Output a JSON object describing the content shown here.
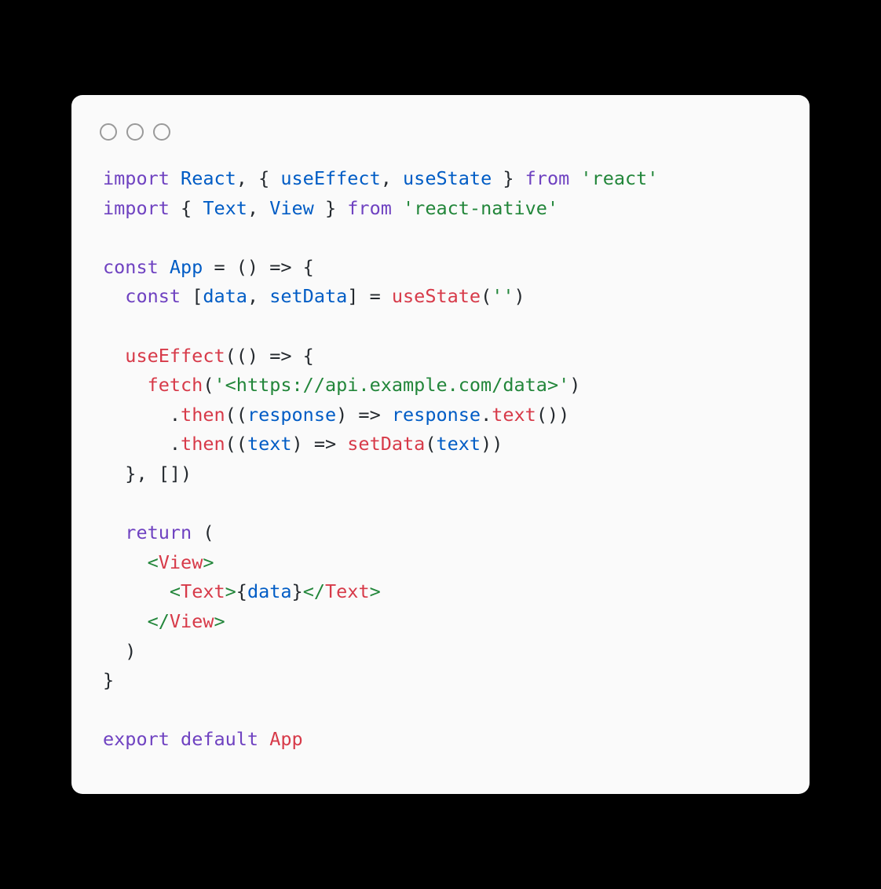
{
  "code": {
    "lines": [
      [
        {
          "t": "import ",
          "c": "kw"
        },
        {
          "t": "React",
          "c": "id"
        },
        {
          "t": ", { ",
          "c": "pn"
        },
        {
          "t": "useEffect",
          "c": "id"
        },
        {
          "t": ", ",
          "c": "pn"
        },
        {
          "t": "useState",
          "c": "id"
        },
        {
          "t": " } ",
          "c": "pn"
        },
        {
          "t": "from ",
          "c": "kw"
        },
        {
          "t": "'react'",
          "c": "str"
        }
      ],
      [
        {
          "t": "import ",
          "c": "kw"
        },
        {
          "t": "{ ",
          "c": "pn"
        },
        {
          "t": "Text",
          "c": "id"
        },
        {
          "t": ", ",
          "c": "pn"
        },
        {
          "t": "View",
          "c": "id"
        },
        {
          "t": " } ",
          "c": "pn"
        },
        {
          "t": "from ",
          "c": "kw"
        },
        {
          "t": "'react-native'",
          "c": "str"
        }
      ],
      [],
      [
        {
          "t": "const ",
          "c": "kw"
        },
        {
          "t": "App",
          "c": "id"
        },
        {
          "t": " = () ",
          "c": "pn"
        },
        {
          "t": "=>",
          "c": "pn"
        },
        {
          "t": " {",
          "c": "pn"
        }
      ],
      [
        {
          "t": "  ",
          "c": "pn"
        },
        {
          "t": "const ",
          "c": "kw"
        },
        {
          "t": "[",
          "c": "pn"
        },
        {
          "t": "data",
          "c": "id"
        },
        {
          "t": ", ",
          "c": "pn"
        },
        {
          "t": "setData",
          "c": "id"
        },
        {
          "t": "] = ",
          "c": "pn"
        },
        {
          "t": "useState",
          "c": "fn"
        },
        {
          "t": "(",
          "c": "pn"
        },
        {
          "t": "''",
          "c": "str"
        },
        {
          "t": ")",
          "c": "pn"
        }
      ],
      [],
      [
        {
          "t": "  ",
          "c": "pn"
        },
        {
          "t": "useEffect",
          "c": "fn"
        },
        {
          "t": "(() ",
          "c": "pn"
        },
        {
          "t": "=>",
          "c": "pn"
        },
        {
          "t": " {",
          "c": "pn"
        }
      ],
      [
        {
          "t": "    ",
          "c": "pn"
        },
        {
          "t": "fetch",
          "c": "fn"
        },
        {
          "t": "(",
          "c": "pn"
        },
        {
          "t": "'<https://api.example.com/data>'",
          "c": "str"
        },
        {
          "t": ")",
          "c": "pn"
        }
      ],
      [
        {
          "t": "      .",
          "c": "pn"
        },
        {
          "t": "then",
          "c": "fn"
        },
        {
          "t": "((",
          "c": "pn"
        },
        {
          "t": "response",
          "c": "id"
        },
        {
          "t": ") ",
          "c": "pn"
        },
        {
          "t": "=>",
          "c": "pn"
        },
        {
          "t": " ",
          "c": "pn"
        },
        {
          "t": "response",
          "c": "id"
        },
        {
          "t": ".",
          "c": "pn"
        },
        {
          "t": "text",
          "c": "fn"
        },
        {
          "t": "())",
          "c": "pn"
        }
      ],
      [
        {
          "t": "      .",
          "c": "pn"
        },
        {
          "t": "then",
          "c": "fn"
        },
        {
          "t": "((",
          "c": "pn"
        },
        {
          "t": "text",
          "c": "id"
        },
        {
          "t": ") ",
          "c": "pn"
        },
        {
          "t": "=>",
          "c": "pn"
        },
        {
          "t": " ",
          "c": "pn"
        },
        {
          "t": "setData",
          "c": "fn"
        },
        {
          "t": "(",
          "c": "pn"
        },
        {
          "t": "text",
          "c": "id"
        },
        {
          "t": "))",
          "c": "pn"
        }
      ],
      [
        {
          "t": "  }, [])",
          "c": "pn"
        }
      ],
      [],
      [
        {
          "t": "  ",
          "c": "pn"
        },
        {
          "t": "return",
          "c": "kw"
        },
        {
          "t": " (",
          "c": "pn"
        }
      ],
      [
        {
          "t": "    ",
          "c": "pn"
        },
        {
          "t": "<",
          "c": "tag"
        },
        {
          "t": "View",
          "c": "tagn"
        },
        {
          "t": ">",
          "c": "tag"
        }
      ],
      [
        {
          "t": "      ",
          "c": "pn"
        },
        {
          "t": "<",
          "c": "tag"
        },
        {
          "t": "Text",
          "c": "tagn"
        },
        {
          "t": ">",
          "c": "tag"
        },
        {
          "t": "{",
          "c": "pn"
        },
        {
          "t": "data",
          "c": "id"
        },
        {
          "t": "}",
          "c": "pn"
        },
        {
          "t": "</",
          "c": "tag"
        },
        {
          "t": "Text",
          "c": "tagn"
        },
        {
          "t": ">",
          "c": "tag"
        }
      ],
      [
        {
          "t": "    ",
          "c": "pn"
        },
        {
          "t": "</",
          "c": "tag"
        },
        {
          "t": "View",
          "c": "tagn"
        },
        {
          "t": ">",
          "c": "tag"
        }
      ],
      [
        {
          "t": "  )",
          "c": "pn"
        }
      ],
      [
        {
          "t": "}",
          "c": "pn"
        }
      ],
      [],
      [
        {
          "t": "export ",
          "c": "kw"
        },
        {
          "t": "default ",
          "c": "kw"
        },
        {
          "t": "App",
          "c": "fn"
        }
      ]
    ]
  }
}
